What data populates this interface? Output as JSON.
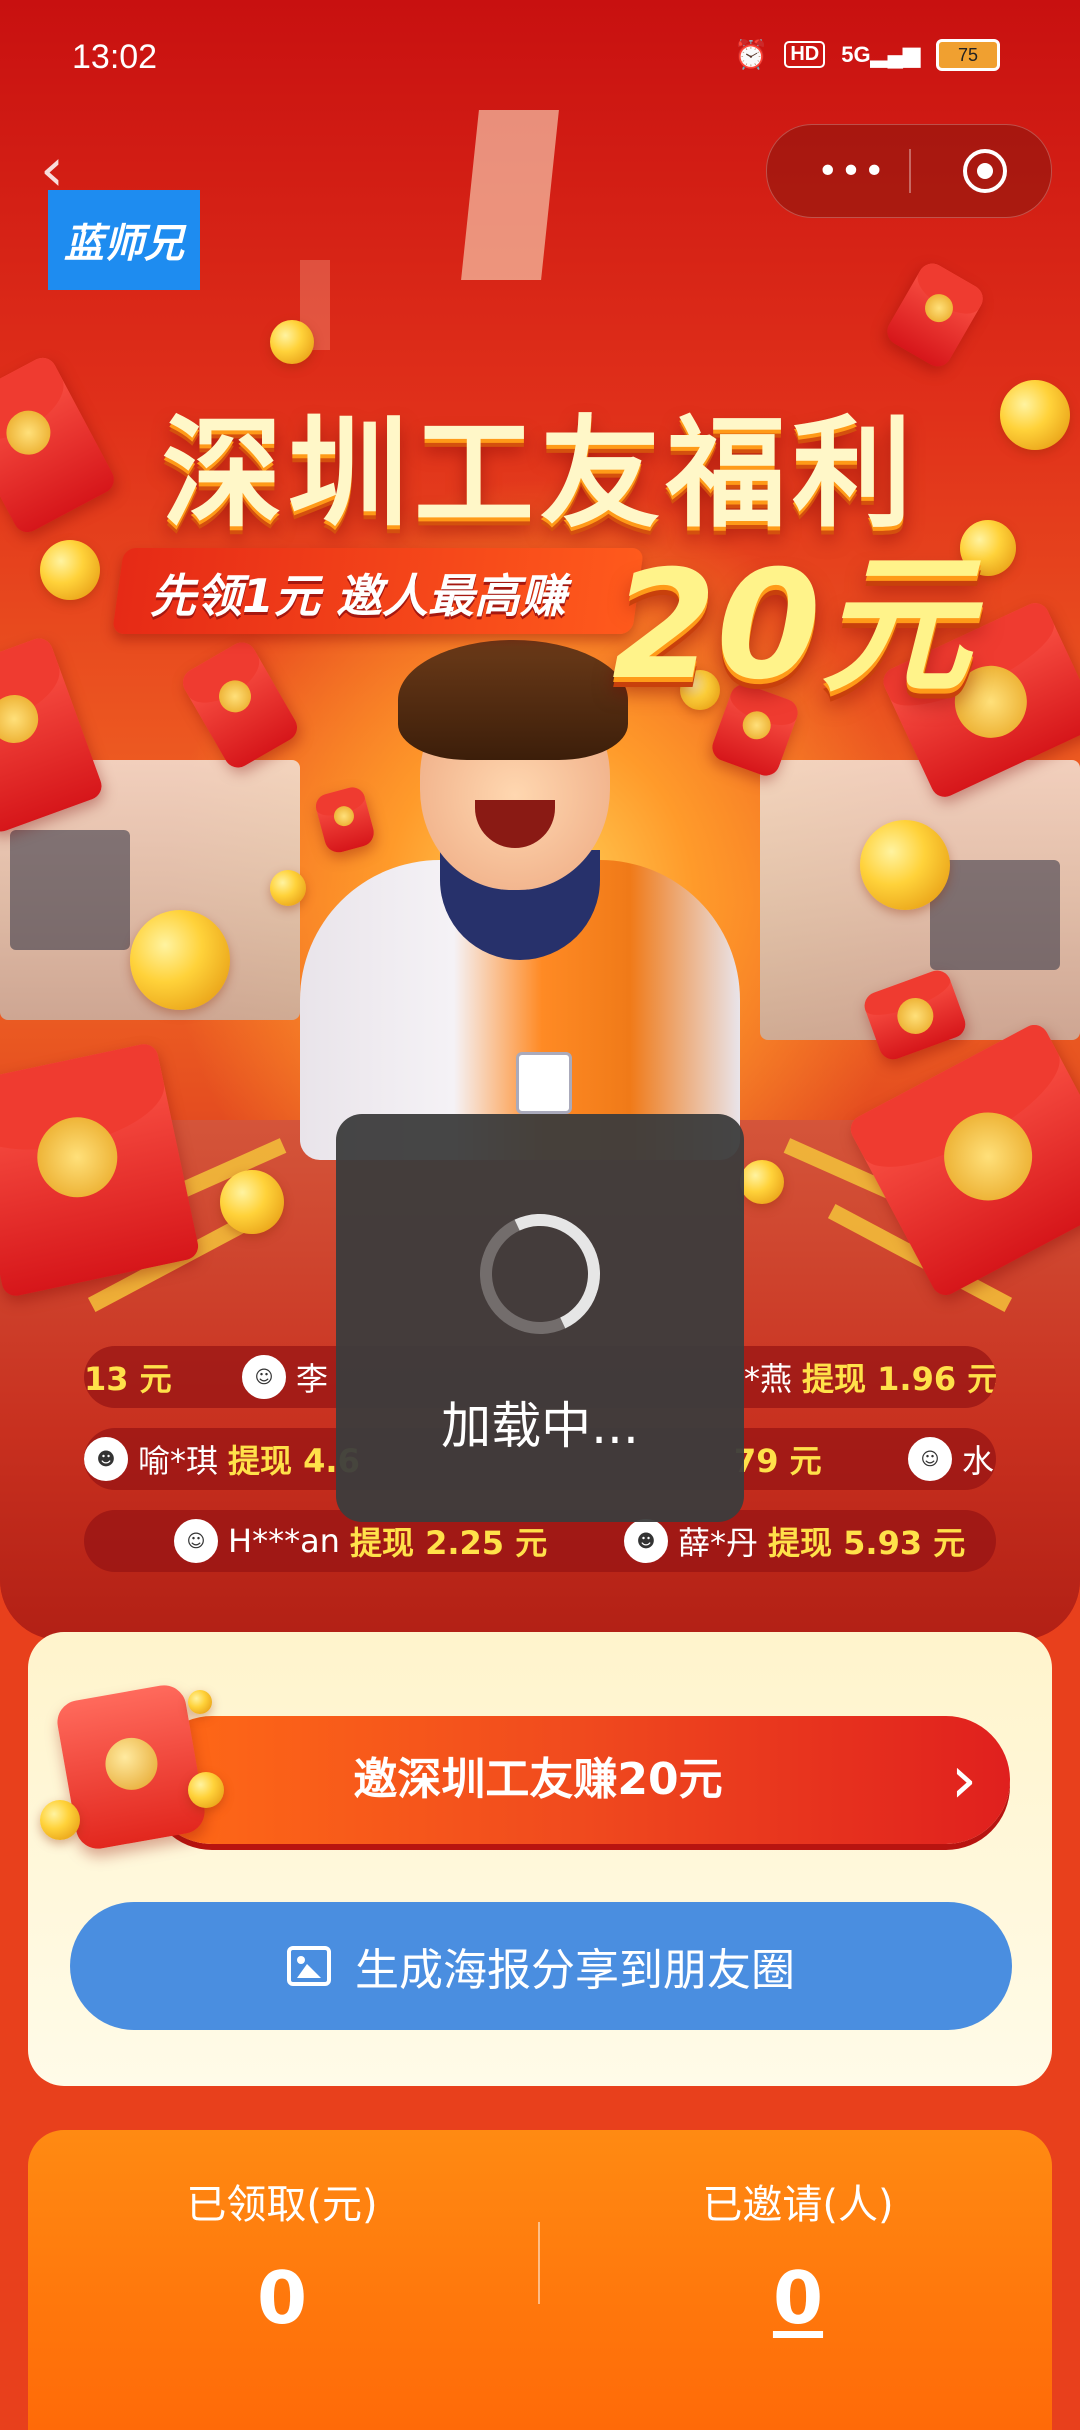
{
  "status_bar": {
    "time": "13:02",
    "hd": "HD",
    "network": "5G",
    "battery": "75"
  },
  "header": {
    "back_glyph": "‹",
    "logo_text": "蓝师兄",
    "menu_glyph": "•••"
  },
  "banner": {
    "title": "深圳工友福利",
    "subtitle": "先领1元 邀人最高赚",
    "amount": "20元"
  },
  "ticker": {
    "rows": [
      [
        {
          "name": "",
          "amount": "13 元"
        },
        {
          "name": "李",
          "amount": ""
        },
        {
          "name": "*燕",
          "amount": "提现 1.96 元"
        }
      ],
      [
        {
          "name": "喻*琪",
          "amount": "提现 4.6"
        },
        {
          "name": "",
          "amount": "79 元"
        },
        {
          "name": "水",
          "amount": ""
        }
      ],
      [
        {
          "name": "",
          "amount": ""
        },
        {
          "name": "H***an",
          "amount": "提现 2.25 元"
        },
        {
          "name": "薛*丹",
          "amount": "提现 5.93 元"
        }
      ]
    ]
  },
  "loading": {
    "text": "加载中..."
  },
  "actions": {
    "invite_label": "邀深圳工友赚20元",
    "invite_chevron": "›",
    "poster_label": "生成海报分享到朋友圈"
  },
  "stats": {
    "received_label": "已领取(元)",
    "received_value": "0",
    "invited_label": "已邀请(人)",
    "invited_value": "0"
  },
  "colors": {
    "primary_red": "#e0201e",
    "accent_orange": "#ff6a08",
    "poster_blue": "#4a8ee0",
    "gold": "#ffe14a"
  }
}
